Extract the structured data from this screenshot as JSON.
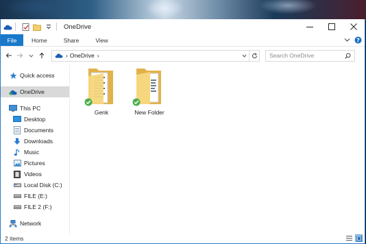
{
  "window": {
    "title": "OneDrive"
  },
  "ribbon": {
    "tabs": [
      "File",
      "Home",
      "Share",
      "View"
    ]
  },
  "navigation": {
    "breadcrumb": [
      "OneDrive"
    ],
    "search_placeholder": "Search OneDrive"
  },
  "sidebar": {
    "items": [
      {
        "label": "Quick access",
        "icon": "star-icon",
        "level": 0
      },
      {
        "label": "OneDrive",
        "icon": "onedrive-cloud-icon",
        "level": 0,
        "selected": true
      },
      {
        "label": "This PC",
        "icon": "computer-icon",
        "level": 0
      },
      {
        "label": "Desktop",
        "icon": "desktop-icon",
        "level": 1
      },
      {
        "label": "Documents",
        "icon": "documents-icon",
        "level": 1
      },
      {
        "label": "Downloads",
        "icon": "downloads-icon",
        "level": 1
      },
      {
        "label": "Music",
        "icon": "music-icon",
        "level": 1
      },
      {
        "label": "Pictures",
        "icon": "pictures-icon",
        "level": 1
      },
      {
        "label": "Videos",
        "icon": "videos-icon",
        "level": 1
      },
      {
        "label": "Local Disk (C:)",
        "icon": "drive-icon",
        "level": 1
      },
      {
        "label": "FILE (E:)",
        "icon": "drive-icon",
        "level": 1
      },
      {
        "label": "FILE 2 (F:)",
        "icon": "drive-icon",
        "level": 1
      },
      {
        "label": "Network",
        "icon": "network-icon",
        "level": 0
      }
    ]
  },
  "files": [
    {
      "name": "Genk",
      "type": "folder",
      "sync_status": "synced"
    },
    {
      "name": "New Folder",
      "type": "folder",
      "sync_status": "synced"
    }
  ],
  "status": {
    "item_count": "2 items"
  },
  "colors": {
    "accent": "#1979ca",
    "selected_nav": "#d9d9d9",
    "folder": "#f5cf6b",
    "sync_green": "#4caf50"
  }
}
